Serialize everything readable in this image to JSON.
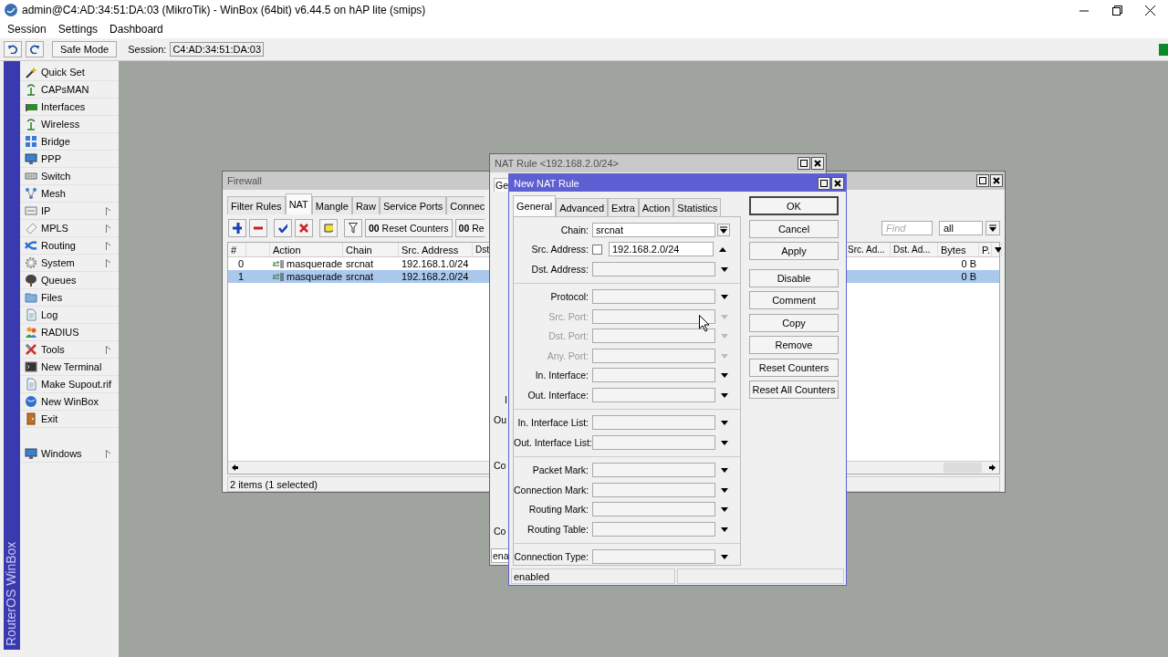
{
  "window": {
    "title": "admin@C4:AD:34:51:DA:03 (MikroTik) - WinBox (64bit) v6.44.5 on hAP lite (smips)"
  },
  "menu": [
    "Session",
    "Settings",
    "Dashboard"
  ],
  "toolbar": {
    "safe_mode": "Safe Mode",
    "session_label": "Session:",
    "session_value": "C4:AD:34:51:DA:03"
  },
  "sidebar": {
    "brand": "RouterOS WinBox",
    "groups": [
      [
        {
          "label": "Quick Set",
          "submenu": false
        },
        {
          "label": "CAPsMAN",
          "submenu": false
        },
        {
          "label": "Interfaces",
          "submenu": false
        },
        {
          "label": "Wireless",
          "submenu": false
        },
        {
          "label": "Bridge",
          "submenu": false
        },
        {
          "label": "PPP",
          "submenu": false
        },
        {
          "label": "Switch",
          "submenu": false
        },
        {
          "label": "Mesh",
          "submenu": false
        },
        {
          "label": "IP",
          "submenu": true
        },
        {
          "label": "MPLS",
          "submenu": true
        },
        {
          "label": "Routing",
          "submenu": true
        },
        {
          "label": "System",
          "submenu": true
        },
        {
          "label": "Queues",
          "submenu": false
        },
        {
          "label": "Files",
          "submenu": false
        },
        {
          "label": "Log",
          "submenu": false
        },
        {
          "label": "RADIUS",
          "submenu": false
        },
        {
          "label": "Tools",
          "submenu": true
        },
        {
          "label": "New Terminal",
          "submenu": false
        },
        {
          "label": "Make Supout.rif",
          "submenu": false
        },
        {
          "label": "New WinBox",
          "submenu": false
        },
        {
          "label": "Exit",
          "submenu": false
        }
      ],
      [
        {
          "label": "Windows",
          "submenu": true
        }
      ]
    ]
  },
  "firewall": {
    "title": "Firewall",
    "tabs": [
      {
        "label": "Filter Rules",
        "selected": false
      },
      {
        "label": "NAT",
        "selected": true
      },
      {
        "label": "Mangle",
        "selected": false
      },
      {
        "label": "Raw",
        "selected": false
      },
      {
        "label": "Service Ports",
        "selected": false
      },
      {
        "label": "Connec",
        "selected": false
      }
    ],
    "text_buttons": [
      "**00** Reset Counters",
      "**00** Re"
    ],
    "find": {
      "placeholder": "Find"
    },
    "filter": "all",
    "columns": [
      "#",
      "Action",
      "Chain",
      "Src. Address",
      "Dst",
      "Src. Ad...",
      "Dst. Ad...",
      "Bytes",
      "P."
    ],
    "rows": [
      {
        "number": "0",
        "action": "masquerade",
        "chain": "srcnat",
        "src_address": "192.168.1.0/24",
        "bytes": "0 B",
        "selected": false
      },
      {
        "number": "1",
        "action": "masquerade",
        "chain": "srcnat",
        "src_address": "192.168.2.0/24",
        "bytes": "0 B",
        "selected": true
      }
    ],
    "status": "2 items (1 selected)"
  },
  "nat_rule": {
    "title": "NAT Rule <192.168.2.0/24>",
    "tab": "Ge",
    "labels": [
      "I",
      "Ou",
      "Co",
      "Co"
    ],
    "status": "ena"
  },
  "new_nat_rule": {
    "title": "New NAT Rule",
    "tabs": [
      {
        "label": "General",
        "selected": true
      },
      {
        "label": "Advanced",
        "selected": false
      },
      {
        "label": "Extra",
        "selected": false
      },
      {
        "label": "Action",
        "selected": false
      },
      {
        "label": "Statistics",
        "selected": false
      }
    ],
    "sections": [
      [
        {
          "label": "Chain:",
          "value": "srcnat",
          "kind": "combo",
          "disabled": false
        },
        {
          "label": "Src. Address:",
          "value": "192.168.2.0/24",
          "kind": "address",
          "negated": false,
          "expanded": true,
          "disabled": false
        },
        {
          "label": "Dst. Address:",
          "kind": "select",
          "expanded": false,
          "disabled": false
        }
      ],
      [
        {
          "label": "Protocol:",
          "kind": "select",
          "expanded": false,
          "disabled": false
        },
        {
          "label": "Src. Port:",
          "kind": "select",
          "expanded": false,
          "disabled": true
        },
        {
          "label": "Dst. Port:",
          "kind": "select",
          "expanded": false,
          "disabled": true
        },
        {
          "label": "Any. Port:",
          "kind": "select",
          "expanded": false,
          "disabled": true
        },
        {
          "label": "In. Interface:",
          "kind": "select",
          "expanded": false,
          "disabled": false
        },
        {
          "label": "Out. Interface:",
          "kind": "select",
          "expanded": false,
          "disabled": false
        }
      ],
      [
        {
          "label": "In. Interface List:",
          "kind": "select",
          "expanded": false,
          "disabled": false
        },
        {
          "label": "Out. Interface List:",
          "kind": "select",
          "expanded": false,
          "disabled": false
        }
      ],
      [
        {
          "label": "Packet Mark:",
          "kind": "select",
          "expanded": false,
          "disabled": false
        },
        {
          "label": "Connection Mark:",
          "kind": "select",
          "expanded": false,
          "disabled": false
        },
        {
          "label": "Routing Mark:",
          "kind": "select",
          "expanded": false,
          "disabled": false
        },
        {
          "label": "Routing Table:",
          "kind": "select",
          "expanded": false,
          "disabled": false
        }
      ],
      [
        {
          "label": "Connection Type:",
          "kind": "select",
          "expanded": false,
          "disabled": false
        }
      ]
    ],
    "buttons": [
      {
        "label": "OK",
        "default": true
      },
      {
        "label": "Cancel",
        "default": false
      },
      {
        "label": "Apply",
        "default": false
      },
      {
        "label": "Disable",
        "default": false
      },
      {
        "label": "Comment",
        "default": false
      },
      {
        "label": "Copy",
        "default": false
      },
      {
        "label": "Remove",
        "default": false
      },
      {
        "label": "Reset Counters",
        "default": false
      },
      {
        "label": "Reset All Counters",
        "default": false
      }
    ],
    "status": "enabled"
  }
}
